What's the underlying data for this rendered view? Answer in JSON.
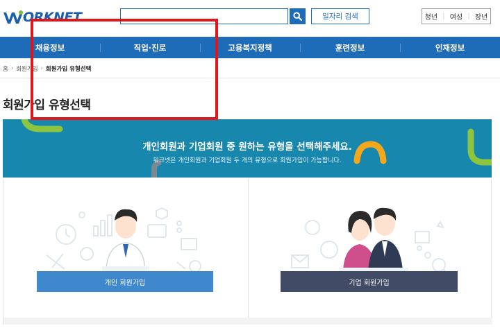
{
  "header": {
    "logo_text": "ORKNET",
    "search_input_value": "",
    "job_search_label": "일자리 검색",
    "util_links": [
      "청년",
      "여성",
      "장년"
    ]
  },
  "nav": {
    "items": [
      "채용정보",
      "직업·진로",
      "고용복지정책",
      "훈련정보",
      "인재정보"
    ]
  },
  "breadcrumb": {
    "home": "홈",
    "level1": "회원가입",
    "current": "회원가입 유형선택"
  },
  "page": {
    "title": "회원가입 유형선택"
  },
  "banner": {
    "main": "개인회원과 기업회원 중 원하는 유형을 선택해주세요.",
    "sub": "워크넷은 개인회원과 기업회원 두 개의 유형으로 회원가입이 가능합니다."
  },
  "cards": {
    "personal_button": "개인 회원가입",
    "corporate_button": "기업 회원가입"
  },
  "colors": {
    "brand_blue": "#1e6bb8",
    "banner_teal": "#1787ad",
    "personal_button": "#3f88cd",
    "corporate_button": "#414b66",
    "highlight_red": "#e0161b"
  }
}
